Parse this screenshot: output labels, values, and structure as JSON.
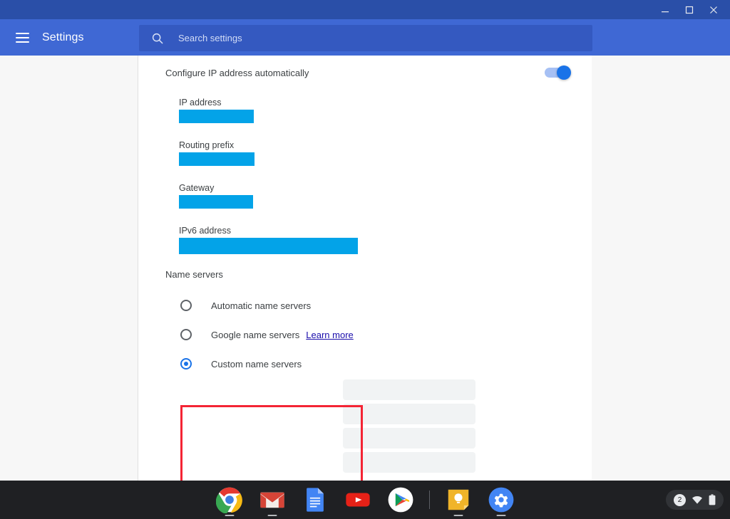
{
  "window": {
    "minimize_label": "Minimize",
    "maximize_label": "Maximize",
    "close_label": "Close"
  },
  "toolbar": {
    "menu_icon": "hamburger-menu-icon",
    "title": "Settings",
    "search": {
      "icon": "search-icon",
      "placeholder": "Search settings",
      "value": ""
    }
  },
  "content": {
    "auto_ip": {
      "label": "Configure IP address automatically",
      "toggle_on": true
    },
    "fields": [
      {
        "label": "IP address",
        "value": "",
        "redacted": true,
        "redact_width": 105
      },
      {
        "label": "Routing prefix",
        "value": "",
        "redacted": true,
        "redact_width": 106
      },
      {
        "label": "Gateway",
        "value": "",
        "redacted": true,
        "redact_width": 104
      },
      {
        "label": "IPv6 address",
        "value": "",
        "redacted": true,
        "redact_width": 251
      }
    ],
    "name_servers": {
      "section_label": "Name servers",
      "options": [
        {
          "label": "Automatic name servers",
          "selected": false
        },
        {
          "label": "Google name servers",
          "selected": false,
          "link": "Learn more"
        },
        {
          "label": "Custom name servers",
          "selected": true
        }
      ],
      "custom_inputs": [
        {
          "value": "",
          "placeholder": ""
        },
        {
          "value": "",
          "placeholder": ""
        },
        {
          "value": "",
          "placeholder": ""
        },
        {
          "value": "",
          "placeholder": ""
        }
      ]
    }
  },
  "annotation": {
    "color": "#f42434",
    "target": "Custom name servers"
  },
  "shelf": {
    "apps": [
      {
        "name": "chrome",
        "label": "Google Chrome",
        "active": true
      },
      {
        "name": "gmail",
        "label": "Gmail",
        "active": true
      },
      {
        "name": "docs",
        "label": "Google Docs",
        "active": false
      },
      {
        "name": "youtube",
        "label": "YouTube",
        "active": false
      },
      {
        "name": "play",
        "label": "Play Store",
        "active": false
      },
      {
        "name": "keep",
        "label": "Google Keep",
        "active": true
      },
      {
        "name": "settings",
        "label": "Settings",
        "active": true
      }
    ],
    "tray": {
      "count": "2",
      "wifi_icon": "wifi-icon",
      "battery_icon": "battery-icon"
    }
  },
  "colors": {
    "titlebar": "#2a4fa8",
    "toolbar": "#3f68d4",
    "searchbox": "#3459c0",
    "accent": "#1a73e8",
    "redaction": "#03a3e8",
    "annotation": "#f42434",
    "shelf": "#1f2023",
    "link": "#1a0dab"
  }
}
